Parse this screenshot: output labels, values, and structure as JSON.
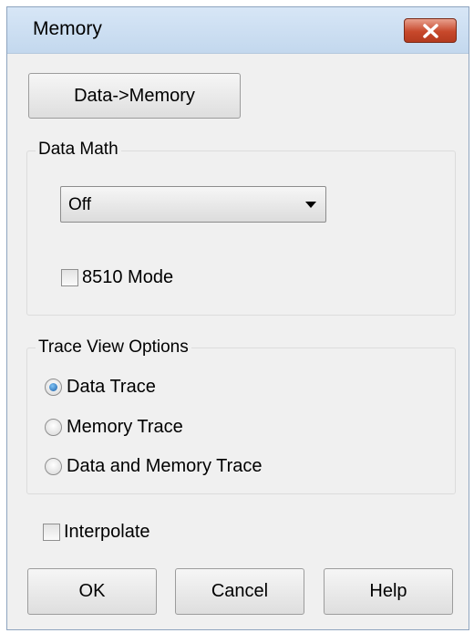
{
  "window": {
    "title": "Memory"
  },
  "buttons": {
    "data_to_memory": "Data->Memory",
    "ok": "OK",
    "cancel": "Cancel",
    "help": "Help"
  },
  "data_math": {
    "group_label": "Data Math",
    "selected": "Off",
    "mode_8510_label": "8510 Mode",
    "mode_8510_checked": false
  },
  "trace_view": {
    "group_label": "Trace View Options",
    "options": [
      "Data Trace",
      "Memory Trace",
      "Data and Memory Trace"
    ],
    "selected": "Data Trace"
  },
  "interpolate": {
    "label": "Interpolate",
    "checked": false
  },
  "colors": {
    "title_bar": "#c9dcf0",
    "close_button": "#c7482b",
    "dialog_bg": "#f0f0f0"
  },
  "icons": {
    "close": "close-icon",
    "dropdown": "chevron-down-icon"
  }
}
